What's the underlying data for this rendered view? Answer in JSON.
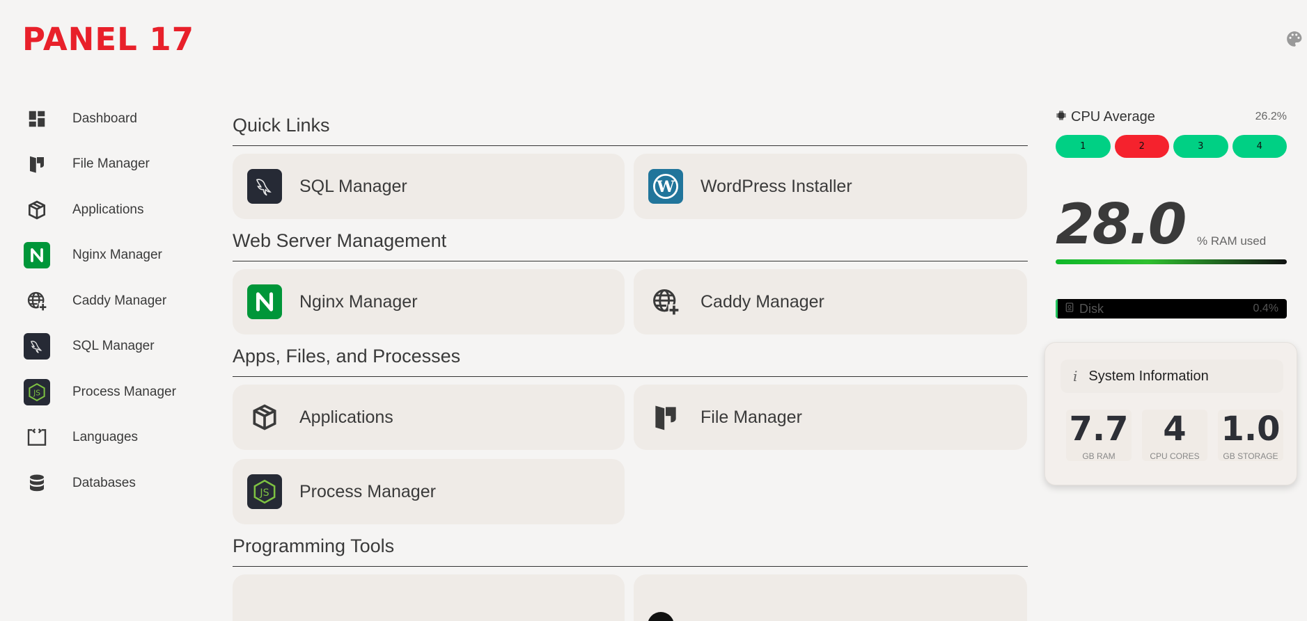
{
  "brand": {
    "logo": "PANEL 17"
  },
  "header": {
    "theme_icon": "palette-icon"
  },
  "sidebar": {
    "items": [
      {
        "label": "Dashboard",
        "icon": "dashboard-icon"
      },
      {
        "label": "File Manager",
        "icon": "folder-icon"
      },
      {
        "label": "Applications",
        "icon": "box-icon"
      },
      {
        "label": "Nginx Manager",
        "icon": "nginx-icon"
      },
      {
        "label": "Caddy Manager",
        "icon": "globe-plus-icon"
      },
      {
        "label": "SQL Manager",
        "icon": "mysql-dolphin-icon"
      },
      {
        "label": "Process Manager",
        "icon": "nodejs-icon"
      },
      {
        "label": "Languages",
        "icon": "code-bracket-icon"
      },
      {
        "label": "Databases",
        "icon": "database-icon"
      }
    ]
  },
  "main": {
    "sections": [
      {
        "title": "Quick Links",
        "cards": [
          {
            "label": "SQL Manager",
            "icon": "mysql-dolphin-icon"
          },
          {
            "label": "WordPress Installer",
            "icon": "wordpress-icon"
          }
        ]
      },
      {
        "title": "Web Server Management",
        "cards": [
          {
            "label": "Nginx Manager",
            "icon": "nginx-icon"
          },
          {
            "label": "Caddy Manager",
            "icon": "globe-plus-icon"
          }
        ]
      },
      {
        "title": "Apps, Files, and Processes",
        "cards": [
          {
            "label": "Applications",
            "icon": "box-icon"
          },
          {
            "label": "File Manager",
            "icon": "folder-icon"
          },
          {
            "label": "Process Manager",
            "icon": "nodejs-icon"
          }
        ]
      },
      {
        "title": "Programming Tools",
        "cards": []
      }
    ]
  },
  "metrics": {
    "cpu": {
      "title": "CPU Average",
      "value": "26.2%",
      "cores": [
        {
          "label": "1",
          "color": "#00d084"
        },
        {
          "label": "2",
          "color": "#f5222d"
        },
        {
          "label": "3",
          "color": "#00d084"
        },
        {
          "label": "4",
          "color": "#00d084"
        }
      ]
    },
    "ram": {
      "value": "28.0",
      "unit": "% RAM used",
      "percent": 28.0
    },
    "disk": {
      "title": "Disk",
      "value": "0.4%",
      "percent": 0.4
    }
  },
  "system_info": {
    "title": "System Information",
    "stats": [
      {
        "value": "7.7",
        "label": "GB RAM"
      },
      {
        "value": "4",
        "label": "CPU CORES"
      },
      {
        "value": "1.0",
        "label": "GB STORAGE"
      }
    ]
  },
  "colors": {
    "brand": "#e8202a",
    "core_ok": "#00d084",
    "core_high": "#f5222d",
    "nginx": "#009639",
    "wordpress": "#21759b",
    "dark_tile": "#262a35"
  }
}
